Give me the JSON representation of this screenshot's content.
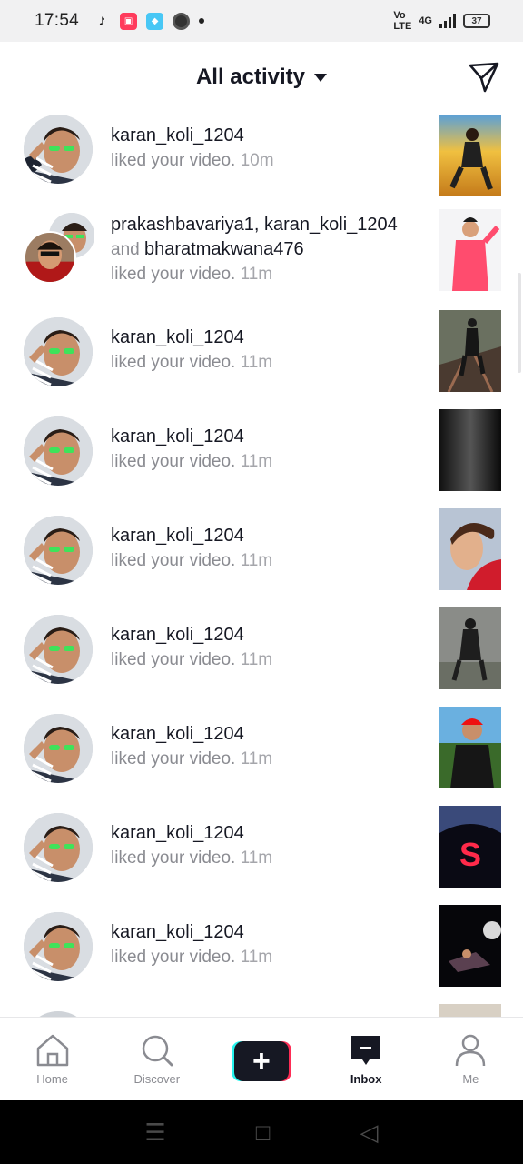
{
  "status_bar": {
    "time": "17:54",
    "network": "4G",
    "battery": "37"
  },
  "header": {
    "title": "All activity"
  },
  "notifications": [
    {
      "users": "karan_koli_1204",
      "action": "liked your video.",
      "time": "10m",
      "multi": false
    },
    {
      "users": "prakashbavariya1, karan_koli_1204",
      "users_more_prefix": "and ",
      "users_more": "bharatmakwana476",
      "action": "liked your video.",
      "time": "11m",
      "multi": true
    },
    {
      "users": "karan_koli_1204",
      "action": "liked your video.",
      "time": "11m",
      "multi": false
    },
    {
      "users": "karan_koli_1204",
      "action": "liked your video.",
      "time": "11m",
      "multi": false
    },
    {
      "users": "karan_koli_1204",
      "action": "liked your video.",
      "time": "11m",
      "multi": false
    },
    {
      "users": "karan_koli_1204",
      "action": "liked your video.",
      "time": "11m",
      "multi": false
    },
    {
      "users": "karan_koli_1204",
      "action": "liked your video.",
      "time": "11m",
      "multi": false
    },
    {
      "users": "karan_koli_1204",
      "action": "liked your video.",
      "time": "11m",
      "multi": false
    },
    {
      "users": "karan_koli_1204",
      "action": "liked your video.",
      "time": "11m",
      "multi": false
    }
  ],
  "bottom_nav": {
    "home": "Home",
    "discover": "Discover",
    "create": "+",
    "inbox": "Inbox",
    "me": "Me"
  },
  "colors": {
    "accent_cyan": "#25f4ee",
    "accent_red": "#fe2c55",
    "text_primary": "#161823",
    "text_secondary": "#8a8b91"
  }
}
